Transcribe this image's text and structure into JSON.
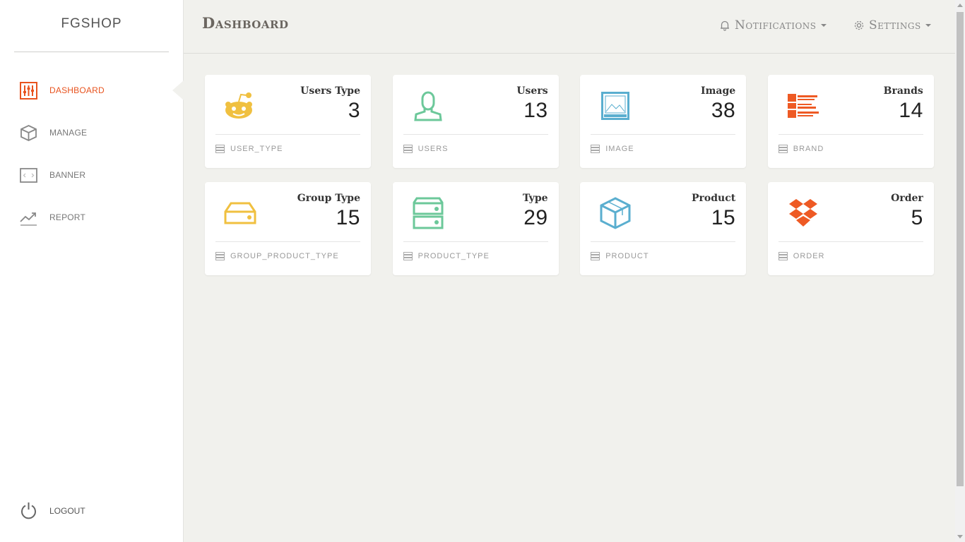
{
  "app": {
    "brand": "FGSHOP"
  },
  "sidebar": {
    "items": [
      {
        "label": "DASHBOARD",
        "icon": "sliders-icon",
        "active": true
      },
      {
        "label": "MANAGE",
        "icon": "box-icon",
        "active": false
      },
      {
        "label": "BANNER",
        "icon": "code-window-icon",
        "active": false
      },
      {
        "label": "REPORT",
        "icon": "trend-icon",
        "active": false
      }
    ],
    "logout": {
      "label": "LOGOUT",
      "icon": "power-icon"
    }
  },
  "header": {
    "title": "Dashboard",
    "notifications": "Notifications",
    "settings": "Settings"
  },
  "colors": {
    "accent": "#e8531e",
    "yellow": "#f0c040",
    "green": "#6cc89a",
    "blue": "#5aaecf",
    "orange": "#ee5a24"
  },
  "cards": [
    {
      "title": "Users Type",
      "count": "3",
      "link": "USER_TYPE",
      "icon": "reddit-icon"
    },
    {
      "title": "Users",
      "count": "13",
      "link": "USERS",
      "icon": "user-icon"
    },
    {
      "title": "Image",
      "count": "38",
      "link": "IMAGE",
      "icon": "image-icon"
    },
    {
      "title": "Brands",
      "count": "14",
      "link": "BRAND",
      "icon": "brands-icon"
    },
    {
      "title": "Group Type",
      "count": "15",
      "link": "GROUP_PRODUCT_TYPE",
      "icon": "drive-icon"
    },
    {
      "title": "Type",
      "count": "29",
      "link": "PRODUCT_TYPE",
      "icon": "server-icon"
    },
    {
      "title": "Product",
      "count": "15",
      "link": "PRODUCT",
      "icon": "cube-icon"
    },
    {
      "title": "Order",
      "count": "5",
      "link": "ORDER",
      "icon": "dropbox-icon"
    }
  ]
}
